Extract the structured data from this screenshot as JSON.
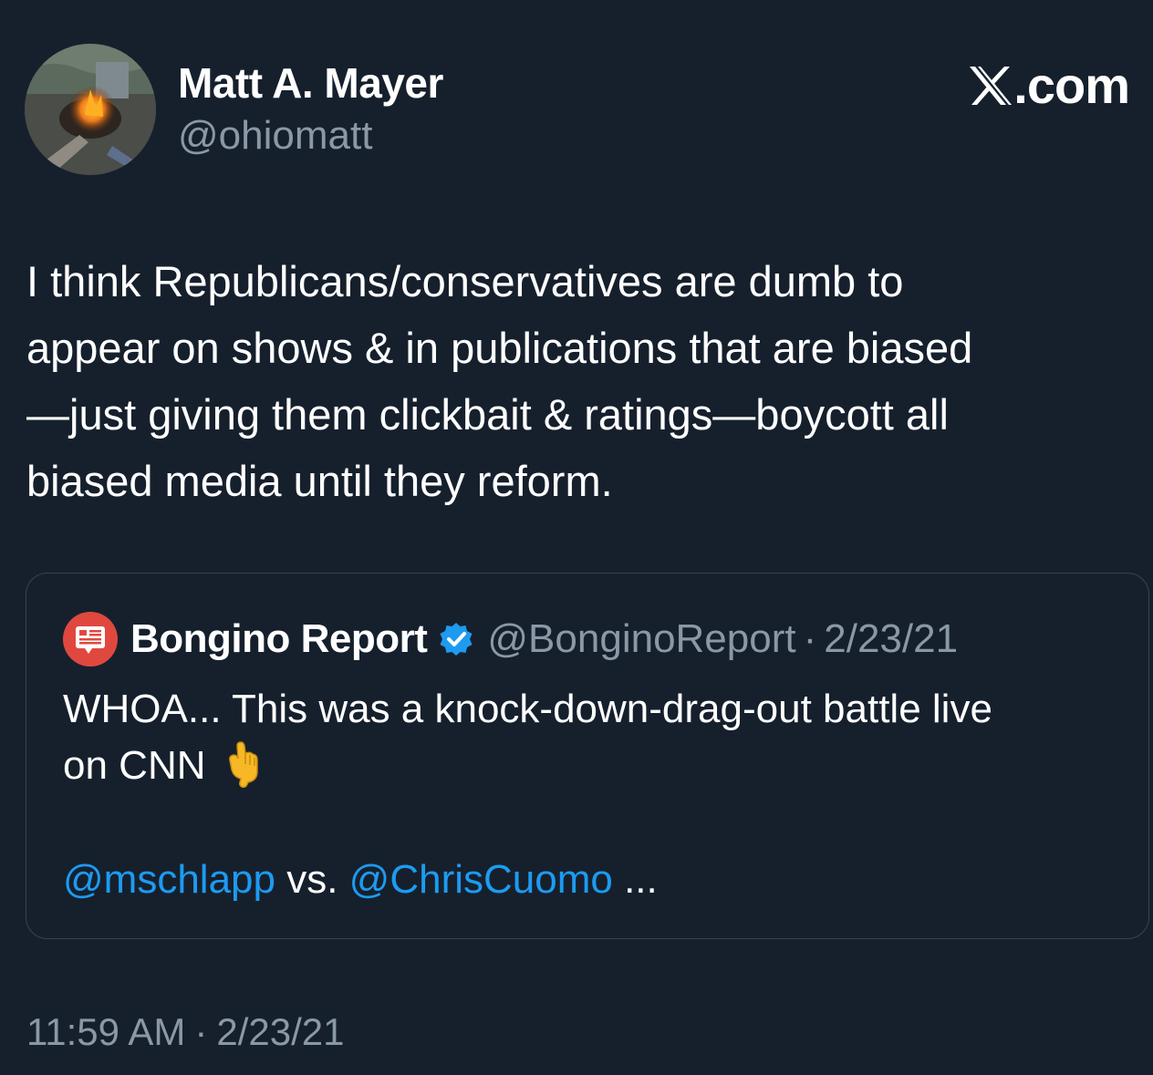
{
  "author": {
    "name": "Matt A. Mayer",
    "handle": "@ohiomatt"
  },
  "brand": {
    "text": ".com"
  },
  "tweet": {
    "text": "I think Republicans/conservatives are dumb to\nappear on shows & in publications that are biased\n—just giving them clickbait & ratings—boycott all\nbiased media until they reform."
  },
  "quote": {
    "name": "Bongino Report",
    "handle": "@BonginoReport",
    "separator": "·",
    "date": "2/23/21",
    "line1": "WHOA... This was a knock-down-drag-out battle live",
    "line2": "on CNN",
    "emoji_icon": "backhand-index-pointing-down-icon",
    "mention1": "@mschlapp",
    "between": " vs. ",
    "mention2": "@ChrisCuomo",
    "ellipsis": " ..."
  },
  "footer": {
    "time": "11:59 AM",
    "separator": "·",
    "date": "2/23/21"
  },
  "colors": {
    "background": "#16202d",
    "secondary_text": "#8b98a5",
    "link": "#1d9bf0",
    "border": "#38444d",
    "verified": "#1d9bf0",
    "bongino_red": "#e0483f"
  }
}
